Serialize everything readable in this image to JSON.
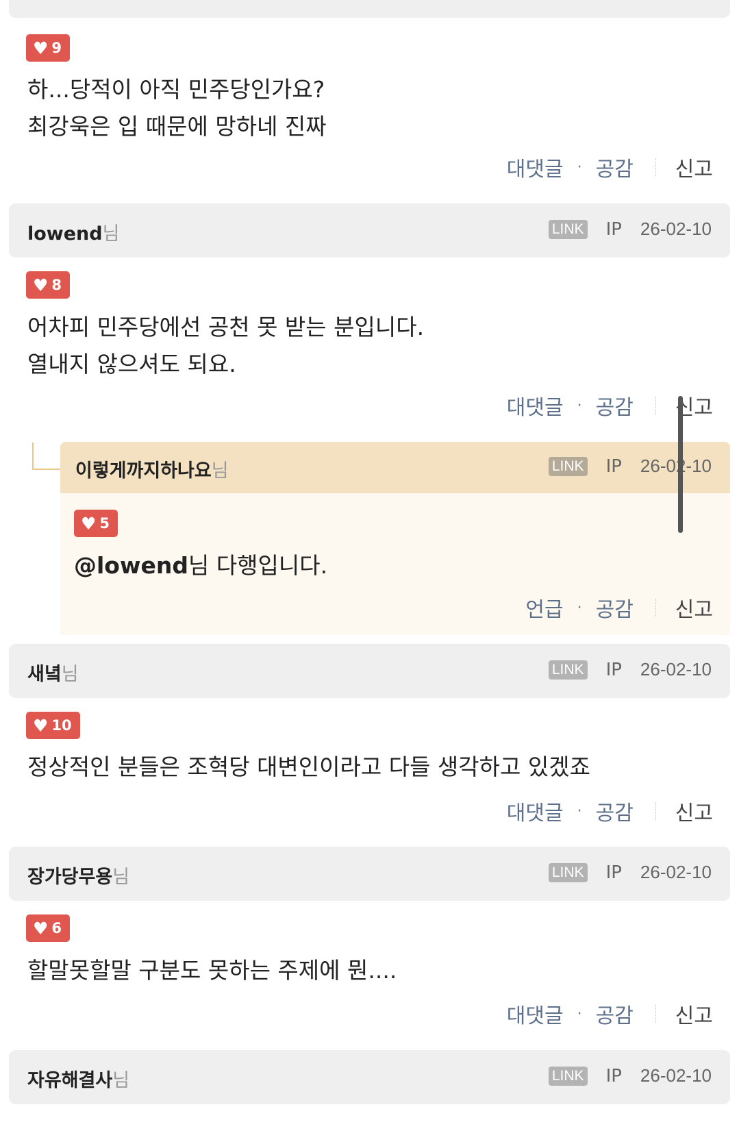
{
  "comments": [
    {
      "likes": "9",
      "lines": [
        "하...당적이 아직 민주당인가요?",
        "최강욱은 입 때문에 망하네 진짜"
      ],
      "actions": {
        "reply": "대댓글",
        "empathy": "공감",
        "report": "신고"
      }
    },
    {
      "author": "lowend",
      "suffix": "님",
      "link": "LINK",
      "ip": "IP",
      "date": "26-02-10",
      "likes": "8",
      "lines": [
        "어차피 민주당에선 공천 못 받는 분입니다.",
        "열내지 않으셔도 되요."
      ],
      "actions": {
        "reply": "대댓글",
        "empathy": "공감",
        "report": "신고"
      }
    },
    {
      "author": "이렇게까지하나요",
      "suffix": "님",
      "link": "LINK",
      "ip": "IP",
      "date": "26-02-10",
      "likes": "5",
      "mention": "@lowend",
      "mention_rest": "님 다행입니다.",
      "actions": {
        "reply": "언급",
        "empathy": "공감",
        "report": "신고"
      }
    },
    {
      "author": "새녘",
      "suffix": "님",
      "link": "LINK",
      "ip": "IP",
      "date": "26-02-10",
      "likes": "10",
      "lines": [
        "정상적인 분들은 조혁당 대변인이라고 다들 생각하고 있겠죠"
      ],
      "actions": {
        "reply": "대댓글",
        "empathy": "공감",
        "report": "신고"
      }
    },
    {
      "author": "장가당무용",
      "suffix": "님",
      "link": "LINK",
      "ip": "IP",
      "date": "26-02-10",
      "likes": "6",
      "lines": [
        "할말못할말 구분도 못하는 주제에 뭔...."
      ],
      "actions": {
        "reply": "대댓글",
        "empathy": "공감",
        "report": "신고"
      }
    },
    {
      "author": "자유해결사",
      "suffix": "님",
      "link": "LINK",
      "ip": "IP",
      "date": "26-02-10"
    }
  ],
  "colors": {
    "like_badge": "#e0574f",
    "action_link": "#5c6f8b",
    "header_bg": "#efefef",
    "reply_header_bg": "#f3e1c1",
    "reply_body_bg": "#fdf8f0"
  }
}
